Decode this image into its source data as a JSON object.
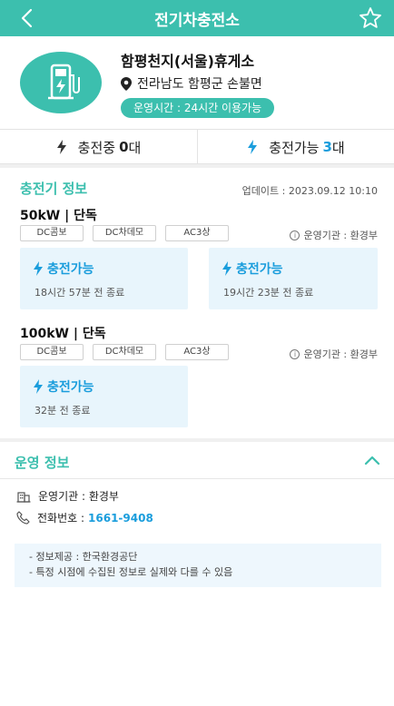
{
  "header": {
    "title": "전기차충전소"
  },
  "station": {
    "name": "함평천지(서울)휴게소",
    "address": "전라남도 함평군 손불면",
    "hours": "운영시간 : 24시간 이용가능"
  },
  "counts": {
    "charging_label": "충전중",
    "charging_count": "0",
    "charging_unit": "대",
    "available_label": "충전가능",
    "available_count": "3",
    "available_unit": "대"
  },
  "charger_info": {
    "title": "충전기 정보",
    "update": "업데이트 : 2023.09.12 10:10",
    "groups": [
      {
        "heading": "50kW  |  단독",
        "tags": [
          "DC콤보",
          "DC차데모",
          "AC3상"
        ],
        "operator": "운영기관 : 환경부",
        "chargers": [
          {
            "status": "충전가능",
            "ended": "18시간 57분 전 종료"
          },
          {
            "status": "충전가능",
            "ended": "19시간 23분 전 종료"
          }
        ]
      },
      {
        "heading": "100kW  |  단독",
        "tags": [
          "DC콤보",
          "DC차데모",
          "AC3상"
        ],
        "operator": "운영기관 : 환경부",
        "chargers": [
          {
            "status": "충전가능",
            "ended": "32분 전 종료"
          }
        ]
      }
    ]
  },
  "operation_info": {
    "title": "운영 정보",
    "operator_label": "운영기관 : 환경부",
    "phone_label": "전화번호 :",
    "phone": "1661-9408",
    "notices": [
      "- 정보제공 : 한국환경공단",
      "- 특정 시점에 수집된 정보로 실제와 다를 수 있음"
    ]
  },
  "icons": {
    "back": "back-arrow-icon",
    "favorite": "star-outline-icon",
    "station": "ev-charger-icon",
    "location": "location-pin-icon",
    "bolt": "lightning-bolt-icon",
    "building": "building-icon",
    "phone": "phone-icon",
    "collapse": "chevron-up-icon",
    "info": "info-circle-icon"
  },
  "colors": {
    "brand": "#3cbfae",
    "accent_blue": "#1a9ddc",
    "card_bg": "#e8f5fc"
  }
}
